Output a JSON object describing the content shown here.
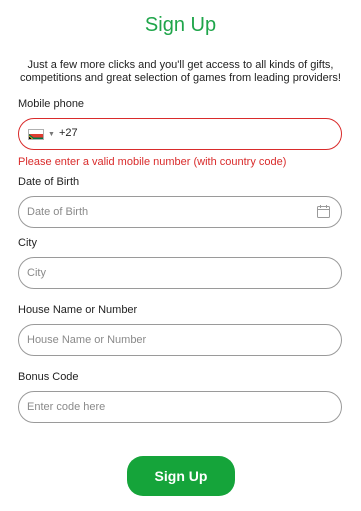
{
  "title": "Sign Up",
  "intro": "Just a few more clicks and you'll get access to all kinds of gifts, competitions and great selection of games from leading providers!",
  "mobile": {
    "label": "Mobile phone",
    "country_code": "+27",
    "value": "",
    "flag": "south-africa-flag",
    "error": "Please enter a valid mobile number (with country code)"
  },
  "dob": {
    "label": "Date of Birth",
    "placeholder": "Date of Birth",
    "icon": "calendar-icon"
  },
  "city": {
    "label": "City",
    "placeholder": "City"
  },
  "house": {
    "label": "House Name or Number",
    "placeholder": "House Name or Number"
  },
  "bonus": {
    "label": "Bonus Code",
    "placeholder": "Enter code here"
  },
  "submit_label": "Sign Up",
  "colors": {
    "accent": "#15a43a",
    "title": "#1fa54a",
    "error": "#d92b2b"
  }
}
